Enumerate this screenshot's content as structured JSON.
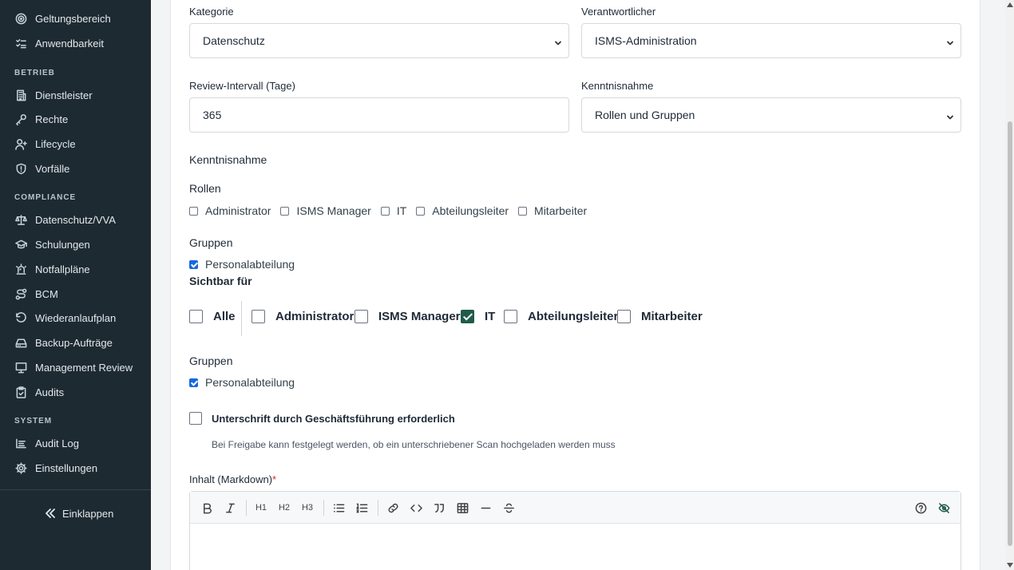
{
  "sidebar": {
    "top_items": [
      {
        "label": "Geltungsbereich",
        "icon": "target-icon"
      },
      {
        "label": "Anwendbarkeit",
        "icon": "checklist-icon"
      }
    ],
    "sections": [
      {
        "title": "BETRIEB",
        "items": [
          {
            "label": "Dienstleister",
            "icon": "building-icon"
          },
          {
            "label": "Rechte",
            "icon": "key-icon"
          },
          {
            "label": "Lifecycle",
            "icon": "user-plus-icon"
          },
          {
            "label": "Vorfälle",
            "icon": "shield-alert-icon"
          }
        ]
      },
      {
        "title": "COMPLIANCE",
        "items": [
          {
            "label": "Datenschutz/VVA",
            "icon": "scale-icon"
          },
          {
            "label": "Schulungen",
            "icon": "graduation-cap-icon"
          },
          {
            "label": "Notfallpläne",
            "icon": "siren-icon"
          },
          {
            "label": "BCM",
            "icon": "route-icon"
          },
          {
            "label": "Wiederanlaufplan",
            "icon": "rotate-ccw-icon"
          },
          {
            "label": "Backup-Aufträge",
            "icon": "hard-drive-icon"
          },
          {
            "label": "Management Review",
            "icon": "presentation-icon"
          },
          {
            "label": "Audits",
            "icon": "clipboard-check-icon"
          }
        ]
      },
      {
        "title": "SYSTEM",
        "items": [
          {
            "label": "Audit Log",
            "icon": "log-icon"
          },
          {
            "label": "Einstellungen",
            "icon": "gear-icon"
          }
        ]
      }
    ],
    "collapse_label": "Einklappen"
  },
  "form": {
    "kategorie": {
      "label": "Kategorie",
      "value": "Datenschutz"
    },
    "verantwortlicher": {
      "label": "Verantwortlicher",
      "value": "ISMS-Administration"
    },
    "review_intervall": {
      "label": "Review-Intervall (Tage)",
      "value": "365"
    },
    "kenntnisnahme_select": {
      "label": "Kenntnisnahme",
      "value": "Rollen und Gruppen"
    },
    "kenntnisnahme": {
      "heading": "Kenntnisnahme",
      "rollen_heading": "Rollen",
      "rollen": [
        {
          "label": "Administrator",
          "checked": false
        },
        {
          "label": "ISMS Manager",
          "checked": false
        },
        {
          "label": "IT",
          "checked": false
        },
        {
          "label": "Abteilungsleiter",
          "checked": false
        },
        {
          "label": "Mitarbeiter",
          "checked": false
        }
      ],
      "gruppen_heading": "Gruppen",
      "gruppen": [
        {
          "label": "Personalabteilung",
          "checked": true
        }
      ]
    },
    "sichtbar": {
      "heading": "Sichtbar für",
      "options": [
        {
          "label": "Alle",
          "checked": false
        },
        {
          "label": "Administrator",
          "checked": false
        },
        {
          "label": "ISMS Manager",
          "checked": false
        },
        {
          "label": "IT",
          "checked": true
        },
        {
          "label": "Abteilungsleiter",
          "checked": false
        },
        {
          "label": "Mitarbeiter",
          "checked": false
        }
      ],
      "gruppen_heading": "Gruppen",
      "gruppen": [
        {
          "label": "Personalabteilung",
          "checked": true
        }
      ]
    },
    "unterschrift": {
      "label": "Unterschrift durch Geschäftsführung erforderlich",
      "checked": false,
      "hint": "Bei Freigabe kann festgelegt werden, ob ein unterschriebener Scan hochgeladen werden muss"
    },
    "inhalt": {
      "label": "Inhalt (Markdown)",
      "required_mark": "*"
    }
  },
  "editor_toolbar": {
    "h1": "H1",
    "h2": "H2",
    "h3": "H3"
  },
  "colors": {
    "sidebar_bg": "#1e2a32",
    "check_blue": "#1769e0",
    "check_green": "#1f5b4a",
    "required": "#d12b2b"
  }
}
